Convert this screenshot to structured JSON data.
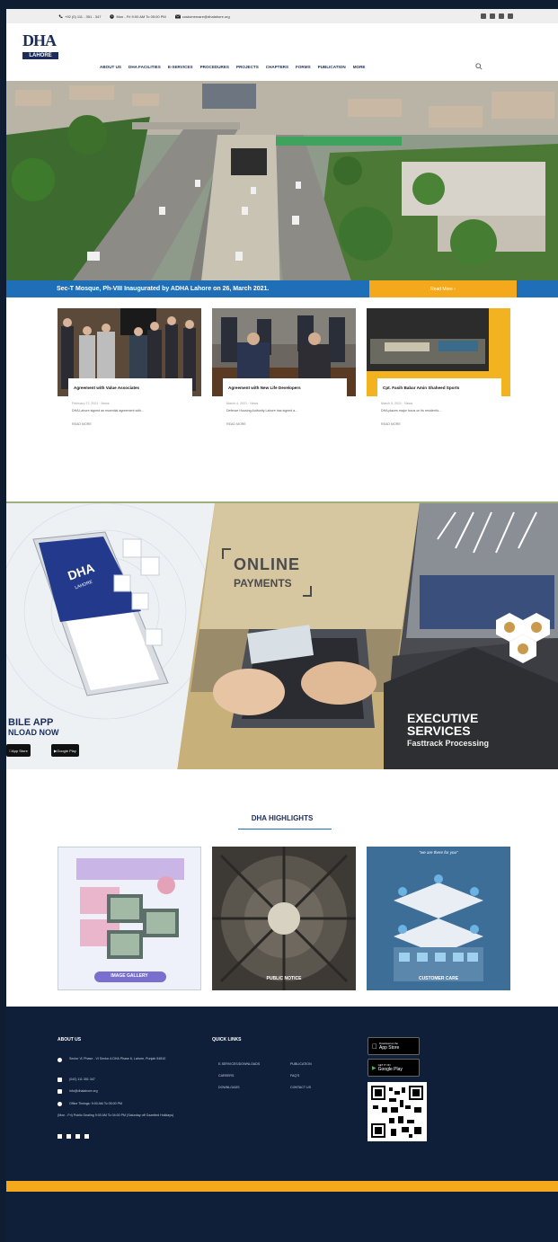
{
  "topbar": {
    "phone": "+92 (0) 111 - 351 - 347",
    "hours": "Mon - Fri 9:00 AM To 05:00 PM",
    "email": "customercare@dhalahore.org"
  },
  "logo": {
    "mark": "DHA",
    "city": "LAHORE"
  },
  "nav": {
    "items": [
      "ABOUT US",
      "DHA FACILITIES",
      "E-SERVICES",
      "PROCEDURES",
      "PROJECTS",
      "CHAPTERS",
      "FORMS",
      "PUBLICATION",
      "MORE"
    ]
  },
  "hero": {
    "caption": "Sec-T Mosque, Ph-VIII Inaugurated by ADHA Lahore on 26, March 2021.",
    "read_more": "Read More"
  },
  "news": [
    {
      "title": "Agreement with Value Associates",
      "meta": "February 27, 2021  ·  News",
      "excerpt": "DHA Lahore signed an essential agreement with...",
      "more": "READ MORE"
    },
    {
      "title": "Agreement with New Life Developers",
      "meta": "March 4, 2021  ·  News",
      "excerpt": "Defence Housing Authority Lahore has signed a...",
      "more": "READ MORE"
    },
    {
      "title": "Cpt. Fasih Babar Amin Shaheed Sports",
      "meta": "March 5, 2021  ·  News",
      "excerpt": "DHA places major focus on its resident's...",
      "more": "READ MORE"
    }
  ],
  "services": {
    "app_title": "BILE APP",
    "app_subtitle": "NLOAD NOW",
    "app_store": "App Store",
    "google_play": "Google Play",
    "phone_brand": "DHA",
    "phone_city": "LAHORE",
    "payments_title": "ONLINE",
    "payments_subtitle": "PAYMENTS",
    "exec_title_1": "EXECUTIVE",
    "exec_title_2": "SERVICES",
    "exec_subtitle": "Fasttrack Processing"
  },
  "highlights": {
    "heading": "DHA HIGHLIGHTS",
    "items": [
      {
        "label": "IMAGE GALLERY"
      },
      {
        "label": "PUBLIC NOTICE"
      },
      {
        "label": "CUSTOMER CARE",
        "tagline": "\"we are there for you\""
      }
    ]
  },
  "footer": {
    "about_heading": "ABOUT US",
    "address": "Sector 'A' Phase - VI Sector A DHA Phase 6, Lahore, Punjab 54810",
    "phone": "(042) 111 351 347",
    "email": "info@dhalahore.org",
    "timing": "Office Timings: 9:00 AM To 05:00 PM",
    "timing_note": "(Mon - Fri) Public Dealing 9:00 AM To 04:00 PM (Saturday off Gazetted Holidays)",
    "quick_heading": "QUICK LINKS",
    "quick_links_col1": [
      "E-SERVICES/DOWNLOADS",
      "CAREERS",
      "DOWNLOADS"
    ],
    "quick_links_col2": [
      "PUBLICATION",
      "FAQ'S",
      "CONTACT US"
    ],
    "app_store_small": "Download on the",
    "app_store": "App Store",
    "google_small": "GET IT ON",
    "google": "Google Play"
  },
  "colors": {
    "navy": "#1c2d5a",
    "blue": "#1e6fb8",
    "orange": "#f3a91b",
    "footer": "#0f1f3a"
  }
}
